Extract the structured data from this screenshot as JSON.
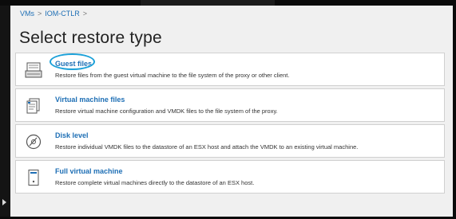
{
  "breadcrumb": {
    "items": [
      "VMs",
      "IOM-CTLR"
    ],
    "separator": ">"
  },
  "page": {
    "title": "Select restore type"
  },
  "options": [
    {
      "title": "Guest files",
      "description": "Restore files from the guest virtual machine to the file system of the proxy or other client.",
      "icon": "guest-files-icon",
      "highlighted": true
    },
    {
      "title": "Virtual machine files",
      "description": "Restore virtual machine configuration and VMDK files to the file system of the proxy.",
      "icon": "vm-files-icon"
    },
    {
      "title": "Disk level",
      "description": "Restore individual VMDK files to the datastore of an ESX host and attach the VMDK to an existing virtual machine.",
      "icon": "disk-icon"
    },
    {
      "title": "Full virtual machine",
      "description": "Restore complete virtual machines directly to the datastore of an ESX host.",
      "icon": "full-vm-icon"
    }
  ],
  "colors": {
    "link": "#1e6fb5",
    "highlight": "#1aa0d8",
    "background": "#f0f0f0"
  }
}
